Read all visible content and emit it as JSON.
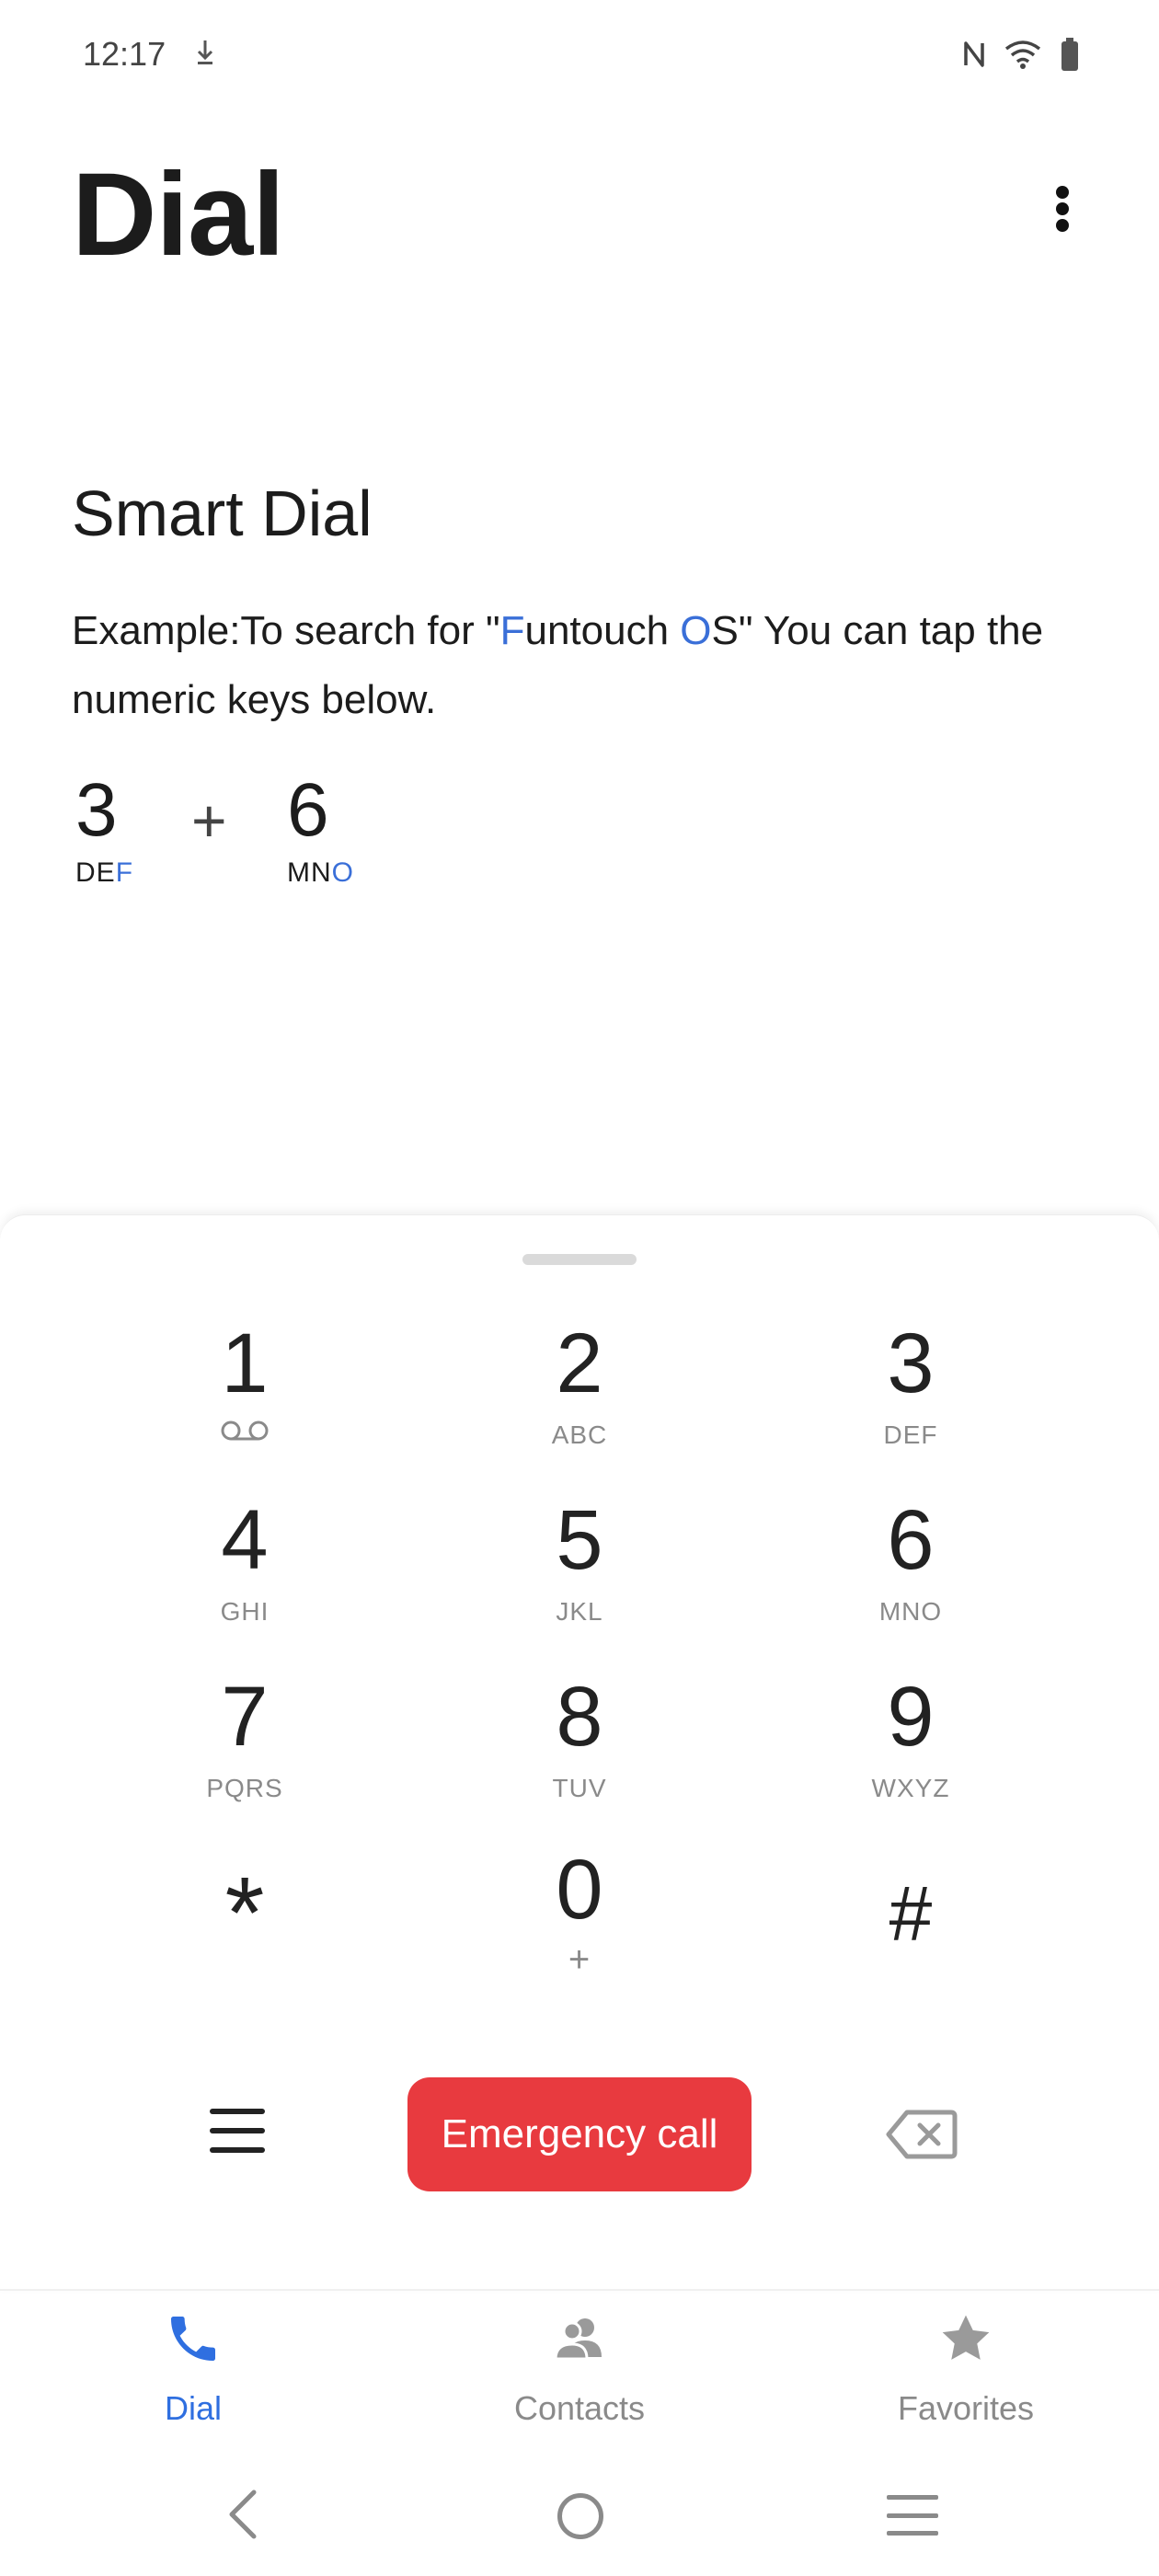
{
  "status_bar": {
    "time": "12:17",
    "icons": [
      "download-icon",
      "nfc-icon",
      "wifi-icon",
      "battery-icon"
    ]
  },
  "header": {
    "title": "Dial"
  },
  "smart_dial": {
    "title": "Smart Dial",
    "text_before": "Example:To search for \"",
    "hl_1": "F",
    "text_mid": "untouch ",
    "hl_2": "O",
    "text_after": "S\" You can tap the numeric keys below.",
    "example": {
      "key_a_digit": "3",
      "key_a_letters": "DE",
      "key_a_hl": "F",
      "plus": "+",
      "key_b_digit": "6",
      "key_b_letters": "MN",
      "key_b_hl": "O"
    }
  },
  "keypad": {
    "keys": [
      {
        "digit": "1",
        "sub": ""
      },
      {
        "digit": "2",
        "sub": "ABC"
      },
      {
        "digit": "3",
        "sub": "DEF"
      },
      {
        "digit": "4",
        "sub": "GHI"
      },
      {
        "digit": "5",
        "sub": "JKL"
      },
      {
        "digit": "6",
        "sub": "MNO"
      },
      {
        "digit": "7",
        "sub": "PQRS"
      },
      {
        "digit": "8",
        "sub": "TUV"
      },
      {
        "digit": "9",
        "sub": "WXYZ"
      },
      {
        "digit": "*",
        "sub": ""
      },
      {
        "digit": "0",
        "sub": "+"
      },
      {
        "digit": "#",
        "sub": ""
      }
    ],
    "emergency_label": "Emergency call"
  },
  "tabs": [
    {
      "label": "Dial",
      "icon": "phone-icon",
      "active": true
    },
    {
      "label": "Contacts",
      "icon": "contacts-icon",
      "active": false
    },
    {
      "label": "Favorites",
      "icon": "star-icon",
      "active": false
    }
  ],
  "colors": {
    "accent": "#2f6fe0",
    "emergency": "#e83a3f",
    "highlight": "#3a6fd8"
  }
}
